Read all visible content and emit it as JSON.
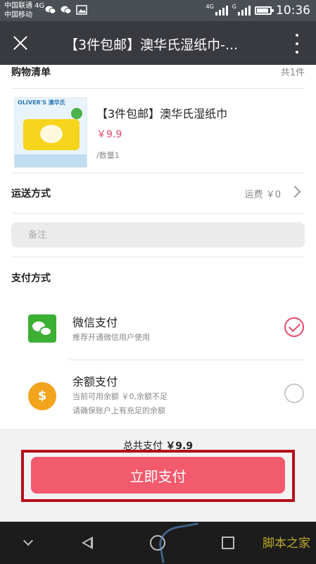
{
  "status_bar": {
    "carrier1": "中国联通 4G",
    "carrier2": "中国移动",
    "time": "10:36",
    "net_label": "4G",
    "net_label2": "G",
    "icons": [
      "wechat-icon",
      "wechat-icon",
      "image-icon",
      "signal-icon",
      "signal-icon",
      "battery-icon"
    ]
  },
  "title_bar": {
    "title": "【3件包邮】澳华氏湿纸巾-..."
  },
  "shopping_list": {
    "title": "购物清单",
    "count": "共1件",
    "item": {
      "name": "【3件包邮】澳华氏湿纸巾",
      "price": "￥9.9",
      "qty": "/数量1",
      "image_brand": "OLIVER'S 澳华氏"
    }
  },
  "shipping": {
    "label": "运送方式",
    "fee": "运费 ￥0"
  },
  "note": {
    "placeholder": "备注"
  },
  "payment": {
    "title": "支付方式",
    "options": [
      {
        "name": "微信支付",
        "desc": "推荐开通微信用户使用",
        "selected": true,
        "icon": "wechat-pay-icon"
      },
      {
        "name": "余额支付",
        "desc1": "当前可用余额 ￥0,余额不足",
        "desc2": "请确保账户上有充足的余额",
        "selected": false,
        "icon": "coin-icon",
        "icon_glyph": "$"
      }
    ]
  },
  "footer": {
    "total_label": "总共支付",
    "total_value": "￥9.9",
    "pay_button": "立即支付"
  },
  "watermark": "脚本之家",
  "colors": {
    "accent": "#f25a6e",
    "price": "#e8486b",
    "highlight": "#b40f1a",
    "titlebar": "#393a3f",
    "wechat_green": "#3cb034",
    "coin": "#f2a41c"
  }
}
